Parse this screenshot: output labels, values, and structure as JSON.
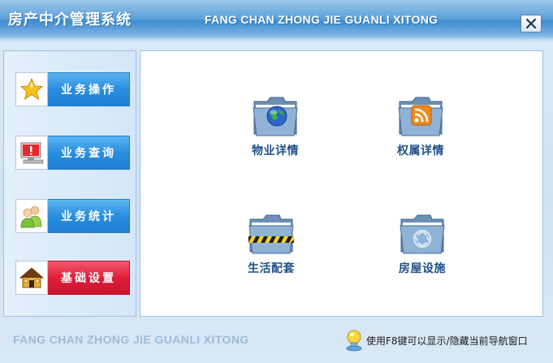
{
  "window": {
    "title": "房产中介管理系统",
    "title_en": "FANG CHAN ZHONG JIE GUANLI XITONG",
    "close_icon": "close-icon"
  },
  "sidebar": {
    "items": [
      {
        "label": "业务操作",
        "icon": "star-icon",
        "active": false
      },
      {
        "label": "业务查询",
        "icon": "alert-monitor-icon",
        "active": false
      },
      {
        "label": "业务统计",
        "icon": "users-icon",
        "active": false
      },
      {
        "label": "基础设置",
        "icon": "house-icon",
        "active": true
      }
    ]
  },
  "main": {
    "tiles": [
      {
        "label": "物业详情",
        "icon": "folder-globe-icon"
      },
      {
        "label": "权属详情",
        "icon": "folder-rss-icon"
      },
      {
        "label": "生活配套",
        "icon": "folder-caution-icon"
      },
      {
        "label": "房屋设施",
        "icon": "folder-recycle-icon"
      }
    ]
  },
  "footer": {
    "brand_en": "FANG CHAN ZHONG JIE GUANLI XITONG",
    "hint": "使用F8键可以显示/隐藏当前导航窗口",
    "hint_icon": "lightbulb-icon"
  },
  "colors": {
    "titlebar": "#3f8bd0",
    "nav_button": "#2a8ee0",
    "nav_button_active": "#e01e3b",
    "tile_label": "#1e4f86"
  }
}
